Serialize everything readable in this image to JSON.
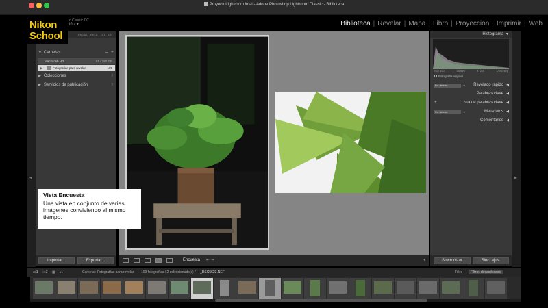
{
  "window": {
    "title": "ProyectoLightroom.lrcat - Adobe Photoshop Lightroom Classic - Biblioteca",
    "traffic_colors": [
      "#fc605b",
      "#fdbc40",
      "#34c84a"
    ]
  },
  "brand": {
    "line1": "Nikon",
    "line2": "School",
    "color": "#f5cc0a"
  },
  "identity": {
    "line1": "n Classic CC",
    "user": "iñiz"
  },
  "modules": [
    "Biblioteca",
    "Revelar",
    "Mapa",
    "Libro",
    "Proyección",
    "Imprimir",
    "Web"
  ],
  "active_module": "Biblioteca",
  "left_panel": {
    "top_bar": [
      "ENCAJ.",
      "RELL.",
      "1:1",
      "1:4"
    ],
    "carpetas": "Carpetas",
    "volume": {
      "name": "Macintosh HD",
      "size": "181 / 250 GB"
    },
    "folder": {
      "name": "Fotografías para revelar",
      "count": "109"
    },
    "colecciones": "Colecciones",
    "servicios": "Servicios de publicación",
    "import_btn": "Importar...",
    "export_btn": "Exportar..."
  },
  "toolbar": {
    "mode": "Encuesta"
  },
  "right_panel": {
    "histogram": "Histograma",
    "exif": [
      "ISO 100",
      "35 mm",
      "f / 2,8",
      "1/250 seg"
    ],
    "original": "Fotografía original",
    "quick_dev": "Revelado rápido",
    "preset": "Por defecto",
    "keywords": "Palabras clave",
    "keyword_list": "Lista de palabras clave",
    "metadata": "Metadatos",
    "comments": "Comentarios",
    "sync_btn": "Sincronizar",
    "sync_settings_btn": "Sinc. ajus."
  },
  "filmbar": {
    "source": "Carpeta : Fotografías para revelar",
    "count": "109 fotografías / 2 seleccionado(s) /",
    "file": "_DSC5623.NEF",
    "filter_label": "Filtro :",
    "filter_value": "Filtros desactivados"
  },
  "callout": {
    "title": "Vista Encuesta",
    "body": "Una vista en conjunto de varias imágenes conviviendo al mismo tiempo."
  }
}
